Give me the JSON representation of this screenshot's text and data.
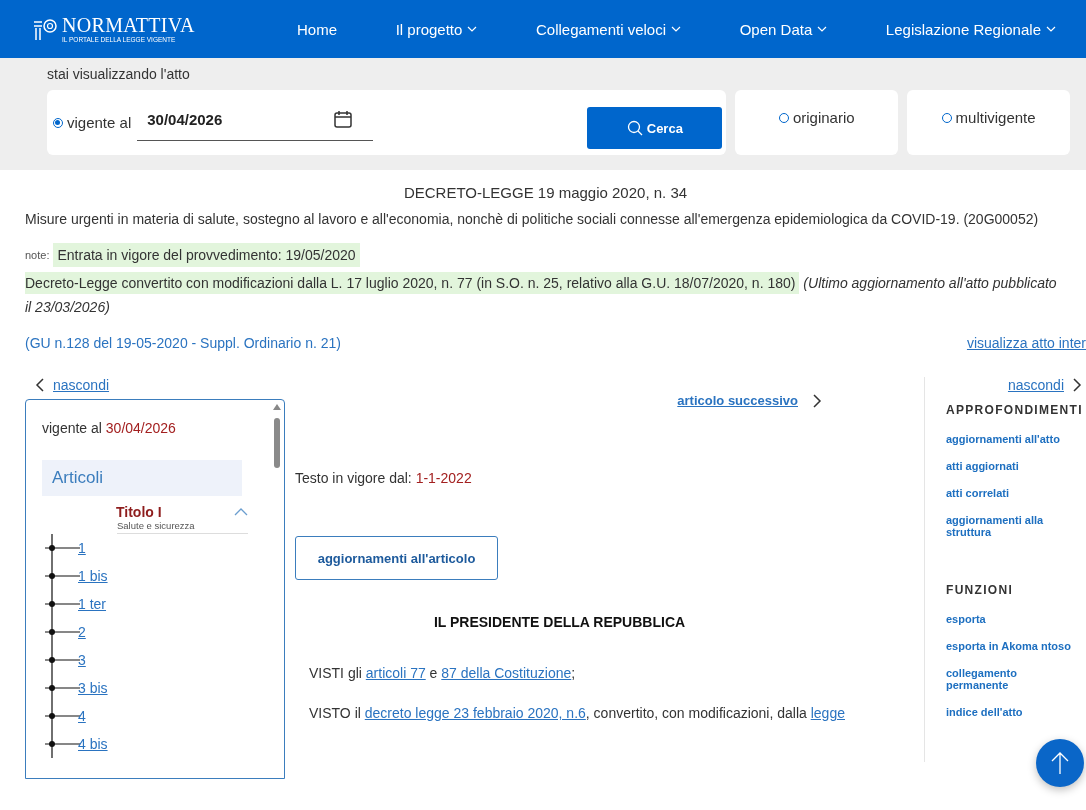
{
  "header": {
    "logo": {
      "title": "NORMATTIVA",
      "subtitle": "IL PORTALE DELLA LEGGE VIGENTE"
    },
    "nav": [
      {
        "label": "Home",
        "dropdown": false
      },
      {
        "label": "Il progetto",
        "dropdown": true
      },
      {
        "label": "Collegamenti veloci",
        "dropdown": true
      },
      {
        "label": "Open Data",
        "dropdown": true
      },
      {
        "label": "Legislazione Regionale",
        "dropdown": true
      }
    ]
  },
  "search": {
    "caption": "stai visualizzando l'atto",
    "date_option": {
      "label": "vigente al",
      "value": "30/04/2026",
      "selected": true
    },
    "button": "Cerca",
    "options": [
      {
        "label": "originario",
        "selected": false
      },
      {
        "label": "multivigente",
        "selected": false
      }
    ]
  },
  "act": {
    "title": "DECRETO-LEGGE 19 maggio 2020, n. 34",
    "description": "Misure urgenti in materia di salute, sostegno al lavoro e all'economia, nonchè di politiche sociali connesse all'emergenza epidemiologica da COVID-19. (20G00052)",
    "note_label": "note:",
    "note": "Entrata in vigore del provvedimento: 19/05/2020",
    "conversion": "Decreto-Legge convertito con modificazioni dalla L. 17 luglio 2020, n. 77 (in S.O. n. 25, relativo alla G.U. 18/07/2020, n. 180)",
    "conversion_note": "(Ultimo aggiornamento all'atto pubblicato il 23/03/2026)",
    "gazette": "(GU n.128 del 19-05-2020 - Suppl. Ordinario n. 21)",
    "view_full": "visualizza atto inter"
  },
  "left_panel": {
    "hide": "nascondi",
    "vigente_label": "vigente al",
    "vigente_date": "30/04/2026",
    "section": "Articoli",
    "title": {
      "label": "Titolo I",
      "subtitle": "Salute e sicurezza",
      "expanded": true
    },
    "articles": [
      "1",
      "1 bis",
      "1 ter",
      "2",
      "3",
      "3 bis",
      "4",
      "4 bis"
    ]
  },
  "article": {
    "next": "articolo successivo",
    "in_force_label": "Testo in vigore dal:",
    "in_force_date": "1-1-2022",
    "updates_button": "aggiornamenti all'articolo",
    "heading": "IL PRESIDENTE DELLA REPUBBLICA",
    "paragraphs": [
      [
        {
          "text": "VISTI gli ",
          "link": false
        },
        {
          "text": "articoli 77",
          "link": true
        },
        {
          "text": " e ",
          "link": false
        },
        {
          "text": "87 della Costituzione",
          "link": true
        },
        {
          "text": ";",
          "link": false
        }
      ],
      [
        {
          "text": "VISTO il ",
          "link": false
        },
        {
          "text": "decreto legge 23 febbraio 2020, n.6",
          "link": true
        },
        {
          "text": ", convertito, con modificazioni, dalla ",
          "link": false
        },
        {
          "text": "legge",
          "link": true
        }
      ]
    ]
  },
  "right_panel": {
    "hide": "nascondi",
    "sections": [
      {
        "heading": "APPROFONDIMENTI",
        "links": [
          "aggiornamenti all'atto",
          "atti aggiornati",
          "atti correlati",
          "aggiornamenti alla struttura"
        ]
      },
      {
        "heading": "FUNZIONI",
        "links": [
          "esporta",
          "esporta in Akoma ntoso",
          "collegamento permanente",
          "indice dell'atto"
        ]
      }
    ]
  }
}
